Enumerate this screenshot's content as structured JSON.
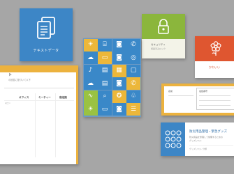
{
  "blue_card": {
    "label": "テキストデータ"
  },
  "green_card": {
    "title": "セキュリティ",
    "subtitle": "施錠済みロック"
  },
  "kawaii_card": {
    "label": "かわいい"
  },
  "table_card": {
    "title": "ト",
    "subtitle": "の回答に基づいて以下",
    "headers": [
      "オフィス",
      "ミーティー",
      "宿泊施"
    ],
    "side_label": "トロン"
  },
  "form_card": {
    "field_a": "名前",
    "field_b": "電話番号"
  },
  "list_card": {
    "title": "防災用品整理・緊急グッズ",
    "line1": "防災用品を整理して常備するための",
    "line2": "グッズリスト",
    "footer": "グッズリスト 分類"
  },
  "icon_grid": [
    [
      "bulb-icon",
      "cylinder-icon",
      "camera-icon",
      "phone-icon"
    ],
    [
      "cloud-icon",
      "monitor-icon",
      "camera-icon",
      "disc-icon"
    ],
    [
      "microphone-icon",
      "film-icon",
      "grid-icon",
      "box-icon"
    ],
    [
      "cloud-icon",
      "film-icon",
      "camera-icon",
      "phone-icon"
    ],
    [
      "wave-icon",
      "search-icon",
      "award-icon",
      "leaf-icon"
    ],
    [
      "bulb-icon",
      "monitor-icon",
      "camera-icon",
      "document-icon"
    ]
  ],
  "icon_glyphs": [
    "⌂",
    "⊙",
    "◉",
    "✆",
    "☁",
    "▭",
    "◎",
    "◷",
    "◍",
    "▤",
    "▦",
    "▢",
    "☼",
    "⌕",
    "✦",
    "♧",
    "☰"
  ],
  "colors": {
    "background": "#a6a6a6",
    "blue": "#3d86c6",
    "yellow": "#ecb23e",
    "green": "#8bb63c",
    "orange": "#df5630"
  }
}
